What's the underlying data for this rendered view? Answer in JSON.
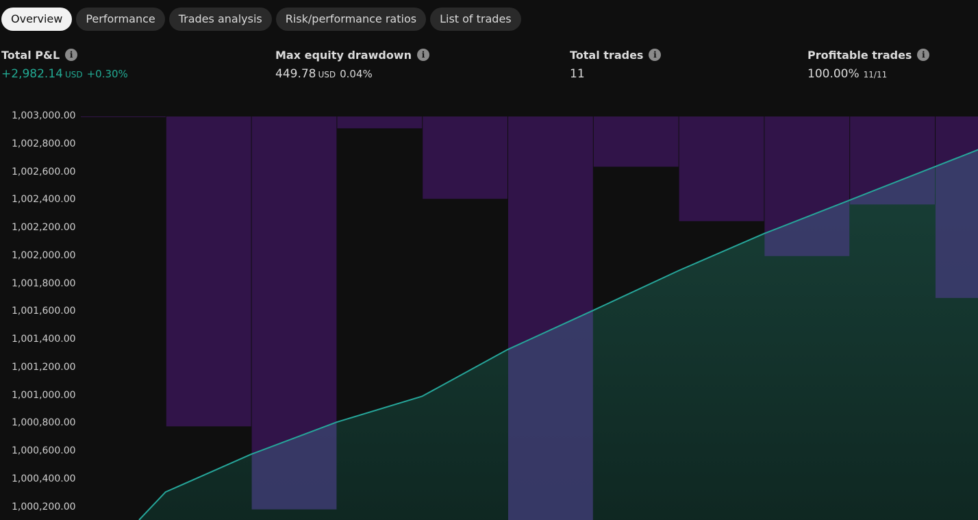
{
  "tabs": [
    {
      "label": "Overview",
      "active": true
    },
    {
      "label": "Performance",
      "active": false
    },
    {
      "label": "Trades analysis",
      "active": false
    },
    {
      "label": "Risk/performance ratios",
      "active": false
    },
    {
      "label": "List of trades",
      "active": false
    }
  ],
  "metrics": {
    "total_pnl": {
      "label": "Total P&L",
      "value": "+2,982.14",
      "unit": "USD",
      "percent": "+0.30%"
    },
    "max_drawdown": {
      "label": "Max equity drawdown",
      "value": "449.78",
      "unit": "USD",
      "percent": "0.04%"
    },
    "total_trades": {
      "label": "Total trades",
      "value": "11"
    },
    "profitable_trades": {
      "label": "Profitable trades",
      "value": "100.00%",
      "ratio": "11/11"
    }
  },
  "info_icon_glyph": "i",
  "colors": {
    "background": "#0f0f0f",
    "positive": "#22ab94",
    "equity_line": "#26a69a",
    "drawdown_bar": "#311449"
  },
  "chart_data": {
    "type": "line",
    "y_tick_labels": [
      "1,003,000.00",
      "1,002,800.00",
      "1,002,600.00",
      "1,002,400.00",
      "1,002,200.00",
      "1,002,000.00",
      "1,001,800.00",
      "1,001,600.00",
      "1,001,400.00",
      "1,001,200.00",
      "1,001,000.00",
      "1,000,800.00",
      "1,000,600.00",
      "1,000,400.00",
      "1,000,200.00"
    ],
    "ylim": [
      1000000,
      1003000
    ],
    "trade_index": [
      0,
      1,
      2,
      3,
      4,
      5,
      6,
      7,
      8,
      9,
      10,
      11
    ],
    "equity": [
      1000000,
      1000310,
      1000580,
      1000810,
      1000995,
      1001330,
      1001610,
      1001895,
      1002160,
      1002400,
      1002640,
      1002880
    ],
    "drawdown_bars_bottom": [
      1003000,
      1000780,
      1000185,
      1002915,
      1002410,
      999950,
      1002640,
      1002250,
      1002000,
      1002370,
      1001700
    ],
    "grid": false,
    "legend": "none"
  }
}
